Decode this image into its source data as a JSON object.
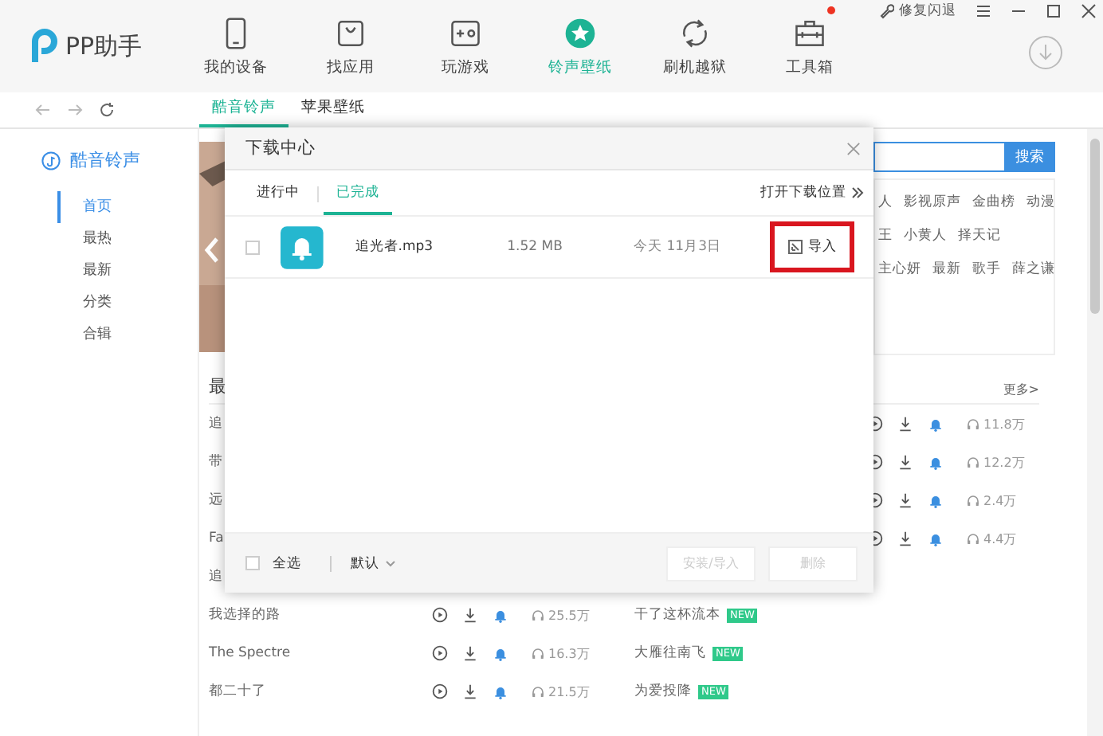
{
  "app": {
    "name": "PP助手"
  },
  "nav": [
    {
      "label": "我的设备",
      "selected": false,
      "badge": false
    },
    {
      "label": "找应用",
      "selected": false,
      "badge": false
    },
    {
      "label": "玩游戏",
      "selected": false,
      "badge": false
    },
    {
      "label": "铃声壁纸",
      "selected": true,
      "badge": false
    },
    {
      "label": "刷机越狱",
      "selected": false,
      "badge": false
    },
    {
      "label": "工具箱",
      "selected": false,
      "badge": true
    }
  ],
  "repair": {
    "label": "修复闪退"
  },
  "subnav": {
    "tabs": [
      {
        "label": "酷音铃声",
        "selected": true
      },
      {
        "label": "苹果壁纸",
        "selected": false
      }
    ]
  },
  "sidebar": {
    "title": "酷音铃声",
    "items": [
      {
        "label": "首页",
        "selected": true
      },
      {
        "label": "最热",
        "selected": false
      },
      {
        "label": "最新",
        "selected": false
      },
      {
        "label": "分类",
        "selected": false
      },
      {
        "label": "合辑",
        "selected": false
      }
    ]
  },
  "search": {
    "button": "搜索"
  },
  "tag_rows": [
    [
      "人",
      "影视原声",
      "金曲榜",
      "动漫"
    ],
    [
      "王",
      "小黄人",
      "择天记"
    ],
    [
      "主心妍",
      "最新",
      "歌手",
      "薛之谦"
    ]
  ],
  "section": {
    "title": "最",
    "more": "更多>"
  },
  "rows": [
    {
      "left": {
        "title": "追"
      },
      "right": {
        "count": "11.8万"
      }
    },
    {
      "left": {
        "title": "带"
      },
      "right": {
        "count": "12.2万"
      }
    },
    {
      "left": {
        "title": "远"
      },
      "right": {
        "count": "2.4万"
      }
    },
    {
      "left": {
        "title": "Fa"
      },
      "right": {
        "count": "4.4万"
      }
    },
    {
      "left": {
        "title": "追"
      },
      "right": {}
    },
    {
      "left": {
        "title": "我选择的路",
        "count": "25.5万"
      },
      "right": {
        "title": "干了这杯流本",
        "badge": "NEW"
      }
    },
    {
      "left": {
        "title": "The Spectre",
        "count": "16.3万"
      },
      "right": {
        "title": "大雁往南飞",
        "badge": "NEW"
      }
    },
    {
      "left": {
        "title": "都二十了",
        "count": "21.5万"
      },
      "right": {
        "title": "为爱投降",
        "badge": "NEW"
      }
    }
  ],
  "dialog": {
    "title": "下载中心",
    "tabs": [
      {
        "label": "进行中",
        "selected": false
      },
      {
        "label": "已完成",
        "selected": true
      }
    ],
    "open_location": "打开下载位置",
    "files": [
      {
        "name": "追光者.mp3",
        "size": "1.52 MB",
        "date": "今天 11月3日",
        "action": "导入",
        "checked": false,
        "highlighted": true
      }
    ],
    "footer": {
      "select_all": "全选",
      "checked": false,
      "sort": "默认",
      "buttons": [
        {
          "label": "安装/导入",
          "disabled": true
        },
        {
          "label": "删除",
          "disabled": true
        }
      ]
    }
  }
}
